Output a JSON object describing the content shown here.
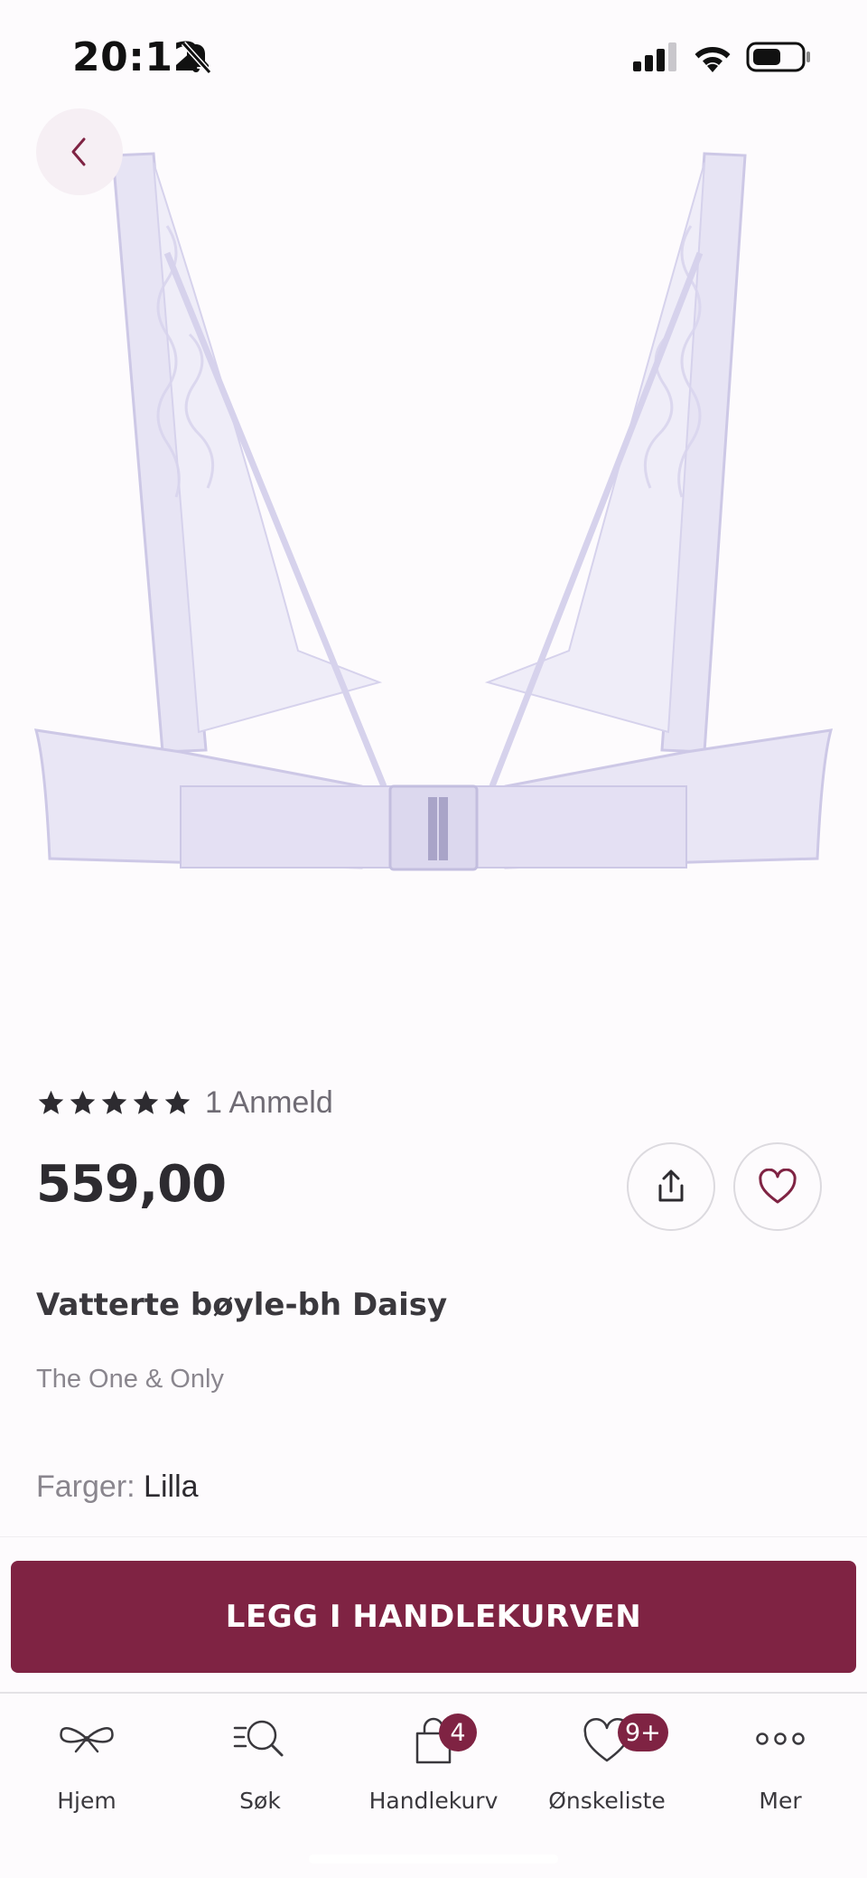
{
  "status_bar": {
    "time": "20:12"
  },
  "product": {
    "rating": 5,
    "review_count_label": "1 Anmeld",
    "price": "559,00",
    "name": "Vatterte bøyle-bh Daisy",
    "brand": "The One & Only",
    "color_label": "Farger:",
    "color_value": "Lilla",
    "image_color": "#d9d5ee"
  },
  "cart": {
    "add_to_cart_label": "LEGG I HANDLEKURVEN"
  },
  "tab_bar": {
    "items": [
      {
        "label": "Hjem",
        "icon": "bow-icon"
      },
      {
        "label": "Søk",
        "icon": "search-icon"
      },
      {
        "label": "Handlekurv",
        "icon": "bag-icon",
        "badge": "4"
      },
      {
        "label": "Ønskeliste",
        "icon": "heart-icon",
        "badge": "9+"
      },
      {
        "label": "Mer",
        "icon": "more-icon"
      }
    ]
  },
  "colors": {
    "accent": "#7f2343",
    "background": "#fdfbfd",
    "text_primary": "#2d2b30",
    "text_secondary": "#8a868e"
  }
}
